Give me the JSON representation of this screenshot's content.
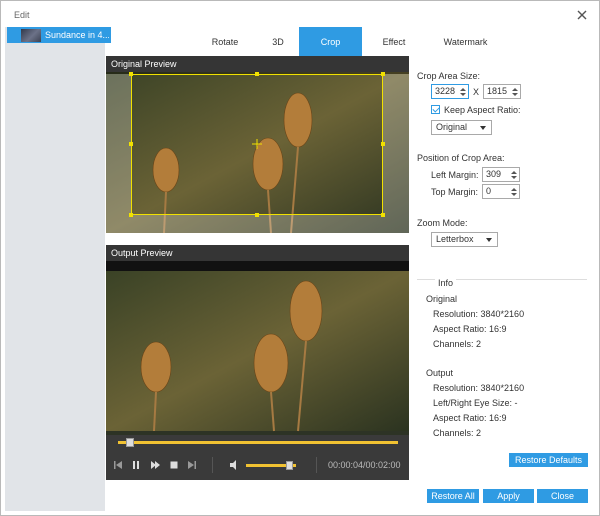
{
  "window": {
    "title": "Edit"
  },
  "sidebar": {
    "items": [
      {
        "label": "Sundance in 4..."
      }
    ]
  },
  "tabs": [
    {
      "label": "Rotate"
    },
    {
      "label": "3D"
    },
    {
      "label": "Crop",
      "active": true
    },
    {
      "label": "Effect"
    },
    {
      "label": "Watermark"
    }
  ],
  "preview": {
    "original_label": "Original Preview",
    "output_label": "Output Preview",
    "time": "00:00:04/00:02:00",
    "progress": 0.03,
    "volume": 0.85
  },
  "crop": {
    "area_size_label": "Crop Area Size:",
    "width": "3228",
    "separator": "X",
    "height": "1815",
    "keep_aspect_label": "Keep Aspect Ratio:",
    "keep_aspect_checked": true,
    "aspect_option": "Original",
    "position_label": "Position of Crop Area:",
    "left_margin_label": "Left Margin:",
    "left_margin": "309",
    "top_margin_label": "Top Margin:",
    "top_margin": "0",
    "zoom_label": "Zoom Mode:",
    "zoom_option": "Letterbox"
  },
  "info": {
    "heading": "Info",
    "original": {
      "heading": "Original",
      "resolution": "Resolution: 3840*2160",
      "aspect": "Aspect Ratio: 16:9",
      "channels": "Channels: 2"
    },
    "output": {
      "heading": "Output",
      "resolution": "Resolution: 3840*2160",
      "eye_size": "Left/Right Eye Size: -",
      "aspect": "Aspect Ratio: 16:9",
      "channels": "Channels: 2"
    }
  },
  "buttons": {
    "restore_defaults": "Restore Defaults",
    "restore_all": "Restore All",
    "apply": "Apply",
    "close": "Close"
  },
  "colors": {
    "accent": "#2f9be3",
    "crop_frame": "#f1e100",
    "seek": "#f1c232"
  }
}
